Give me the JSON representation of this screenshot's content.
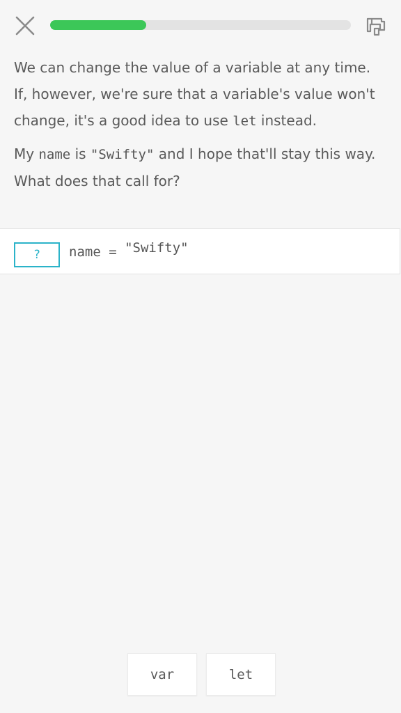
{
  "header": {
    "close_icon": "close-icon",
    "progress": 0.32,
    "progress_color": "#3cc758",
    "cheatsheet_icon": "cheatsheet-icon"
  },
  "lesson": {
    "p1_text": "We can change the value of a variable at any time. If, however, we're sure that a variable's value won't change, it's a good idea to use ",
    "p1_code": "let",
    "p1_end": " instead.",
    "p2_start": "My ",
    "p2_code1": "name",
    "p2_mid": " is ",
    "p2_code2": "\"Swifty\"",
    "p2_end": " and I hope that'll stay this way. What does that call for?"
  },
  "code": {
    "blank_placeholder": "?",
    "line_prefix": "name = ",
    "line_string": "\"Swifty\"",
    "accent_color": "#2bb3c9"
  },
  "options": [
    {
      "label": "var"
    },
    {
      "label": "let"
    }
  ]
}
